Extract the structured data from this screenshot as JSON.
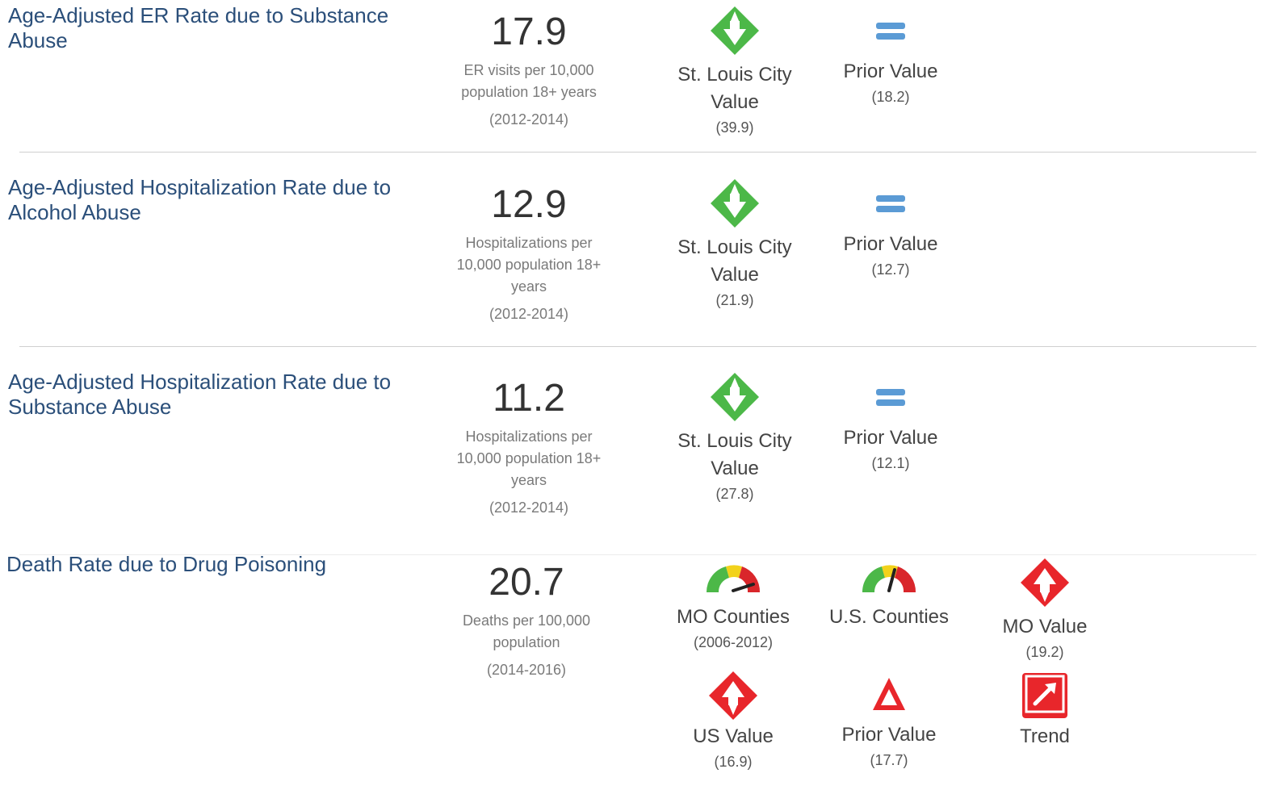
{
  "colors": {
    "title": "#2b4f7a",
    "good_green": "#4cb848",
    "equal_blue": "#5b9bd5",
    "bad_red": "#e8262b"
  },
  "indicators": [
    {
      "title": "Age-Adjusted ER Rate due to Substance Abuse",
      "value": "17.9",
      "unit": "ER visits per 10,000 population 18+ years",
      "period": "(2012-2014)",
      "comparisons": [
        {
          "icon": "green-diamond-down-icon",
          "label": "St. Louis City Value",
          "sub": "(39.9)"
        },
        {
          "icon": "equal-icon",
          "label": "Prior Value",
          "sub": "(18.2)"
        }
      ]
    },
    {
      "title": "Age-Adjusted Hospitalization Rate due to Alcohol Abuse",
      "value": "12.9",
      "unit": "Hospitalizations per 10,000 population 18+ years",
      "period": "(2012-2014)",
      "comparisons": [
        {
          "icon": "green-diamond-down-icon",
          "label": "St. Louis City Value",
          "sub": "(21.9)"
        },
        {
          "icon": "equal-icon",
          "label": "Prior Value",
          "sub": "(12.7)"
        }
      ]
    },
    {
      "title": "Age-Adjusted Hospitalization Rate due to Substance Abuse",
      "value": "11.2",
      "unit": "Hospitalizations per 10,000 population 18+ years",
      "period": "(2012-2014)",
      "comparisons": [
        {
          "icon": "green-diamond-down-icon",
          "label": "St. Louis City Value",
          "sub": "(27.8)"
        },
        {
          "icon": "equal-icon",
          "label": "Prior Value",
          "sub": "(12.1)"
        }
      ]
    },
    {
      "title": "Death Rate due to Drug Poisoning",
      "value": "20.7",
      "unit": "Deaths per 100,000 population",
      "period": "(2014-2016)",
      "comparisons": [
        {
          "icon": "gauge-icon",
          "label": "MO Counties",
          "sub": "(2006-2012)"
        },
        {
          "icon": "gauge-icon",
          "label": "U.S. Counties",
          "sub": ""
        },
        {
          "icon": "red-diamond-up-icon",
          "label": "MO Value",
          "sub": "(19.2)"
        },
        {
          "icon": "red-diamond-up-icon",
          "label": "US Value",
          "sub": "(16.9)"
        },
        {
          "icon": "red-triangle-up-icon",
          "label": "Prior Value",
          "sub": "(17.7)"
        },
        {
          "icon": "trend-icon",
          "label": "Trend",
          "sub": ""
        }
      ]
    }
  ]
}
